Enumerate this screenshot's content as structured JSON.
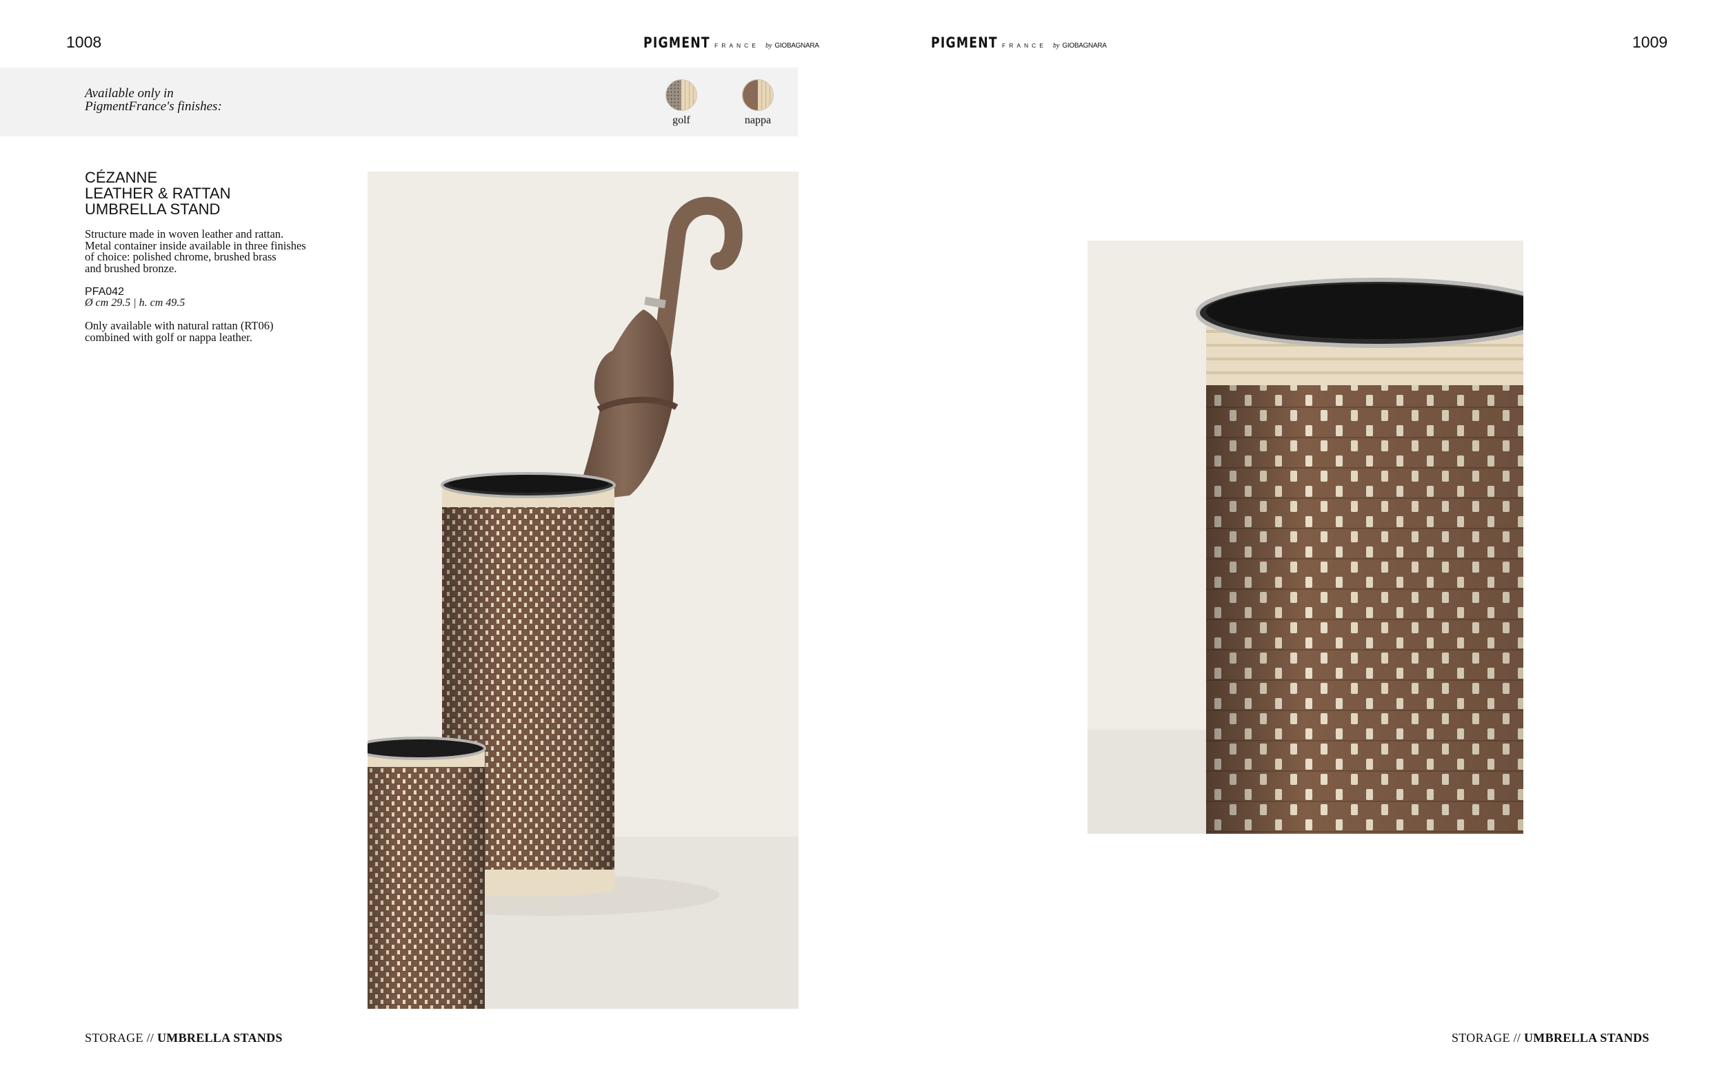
{
  "spread": {
    "left_page_number": "1008",
    "right_page_number": "1009"
  },
  "brand": {
    "name": "PIGMENT",
    "sub": "FRANCE",
    "by": "by",
    "maker": "GIOBAGNARA"
  },
  "finishes": {
    "label": "Available only in PigmentFrance's finishes:",
    "items": [
      {
        "name": "golf",
        "icon": "golf-rattan-swatch-icon",
        "color": "#9c9185"
      },
      {
        "name": "nappa",
        "icon": "nappa-rattan-swatch-icon",
        "color": "#8a6b58"
      }
    ]
  },
  "product": {
    "title": "CÉZANNE\nLEATHER & RATTAN\nUMBRELLA STAND",
    "description": "Structure made in woven leather and rattan.\nMetal container inside available in three finishes\nof choice: polished chrome, brushed brass\nand brushed bronze.",
    "code": "PFA042",
    "dimensions": "Ø cm 29.5 | h. cm 49.5",
    "note": "Only available with natural rattan (RT06)\ncombined with golf or nappa leather."
  },
  "footer": {
    "section": "STORAGE //",
    "category": "UMBRELLA STANDS"
  },
  "colors": {
    "leather": "#7a5a46",
    "rattan": "#e9dcc4",
    "umbrella": "#7d6250",
    "band": "#f2f2f2"
  }
}
